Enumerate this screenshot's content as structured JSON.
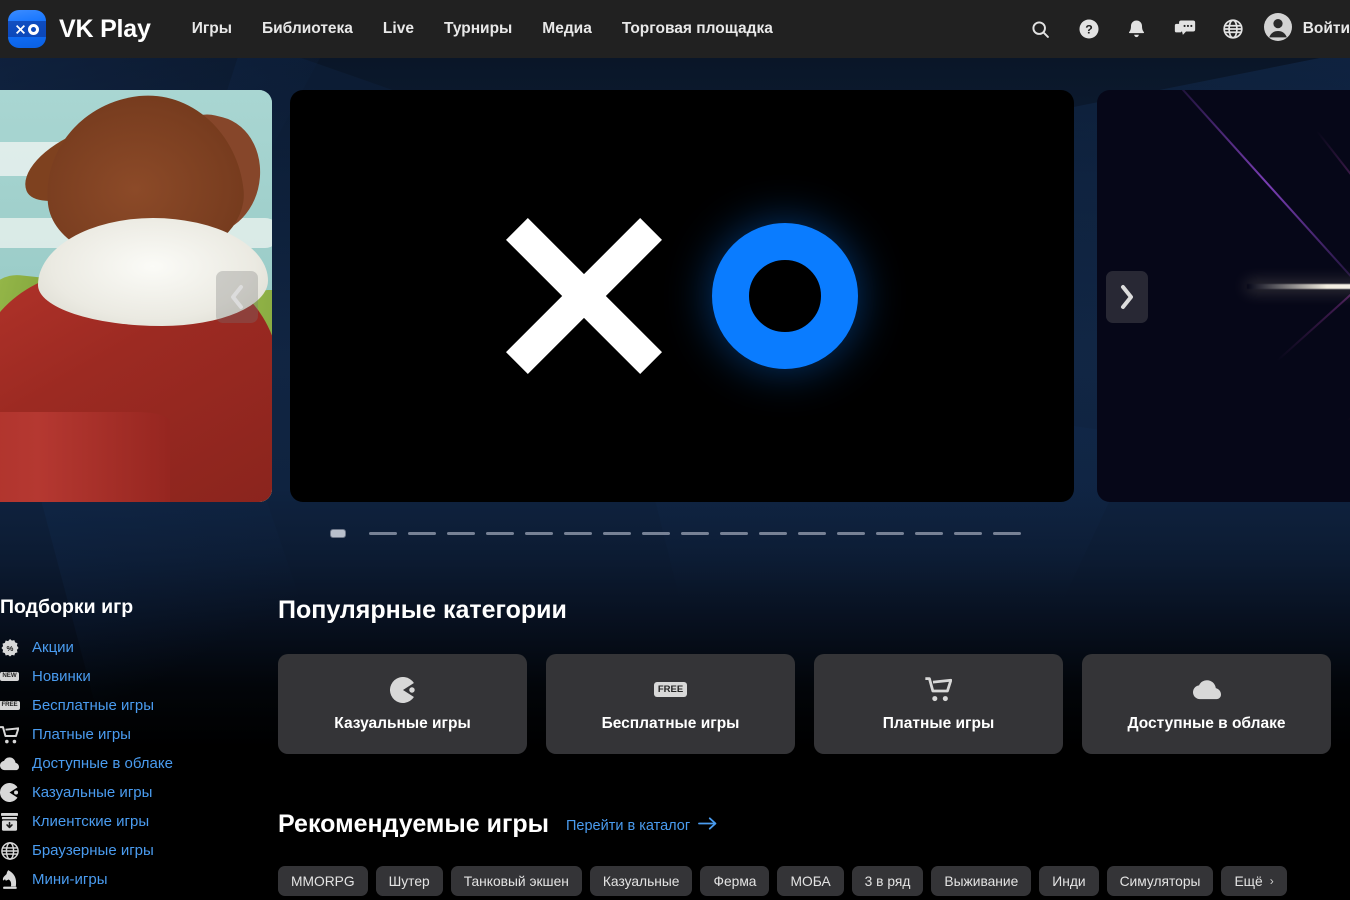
{
  "header": {
    "brand": "VK Play",
    "logo_icon": "vkplay-xo-logo-icon",
    "nav": [
      {
        "label": "Игры"
      },
      {
        "label": "Библиотека"
      },
      {
        "label": "Live"
      },
      {
        "label": "Турниры"
      },
      {
        "label": "Медиа"
      },
      {
        "label": "Торговая площадка"
      }
    ],
    "icons": [
      {
        "name": "search-icon"
      },
      {
        "name": "help-icon"
      },
      {
        "name": "notifications-bell-icon"
      },
      {
        "name": "chat-icon"
      },
      {
        "name": "language-globe-icon"
      }
    ],
    "login_label": "Войти",
    "avatar_icon": "user-avatar-icon"
  },
  "carousel": {
    "prev_label": "‹",
    "next_label": "›",
    "active_index": 0,
    "slide_count": 18,
    "main_slide": {
      "logo": "xo-logo",
      "x_color": "#ffffff",
      "o_color": "#0a7cff",
      "background": "#000000"
    }
  },
  "sidebar": {
    "title": "Подборки игр",
    "items": [
      {
        "label": "Акции",
        "icon": "discount-percent-icon"
      },
      {
        "label": "Новинки",
        "icon": "new-badge-icon",
        "badge": "NEW"
      },
      {
        "label": "Бесплатные игры",
        "icon": "free-badge-icon",
        "badge": "FREE"
      },
      {
        "label": "Платные игры",
        "icon": "shopping-cart-icon"
      },
      {
        "label": "Доступные в облаке",
        "icon": "cloud-icon"
      },
      {
        "label": "Казуальные игры",
        "icon": "pacman-icon"
      },
      {
        "label": "Клиентские игры",
        "icon": "download-box-icon"
      },
      {
        "label": "Браузерные игры",
        "icon": "globe-icon"
      },
      {
        "label": "Мини-игры",
        "icon": "chess-knight-icon"
      }
    ]
  },
  "main": {
    "categories_title": "Популярные категории",
    "categories": [
      {
        "label": "Казуальные игры",
        "icon": "pacman-icon"
      },
      {
        "label": "Бесплатные игры",
        "icon": "free-badge-icon",
        "badge": "FREE"
      },
      {
        "label": "Платные игры",
        "icon": "shopping-cart-icon"
      },
      {
        "label": "Доступные в облаке",
        "icon": "cloud-icon"
      }
    ],
    "recommended_title": "Рекомендуемые игры",
    "catalog_link": "Перейти в каталог",
    "catalog_link_icon": "arrow-right-icon",
    "tags": [
      {
        "label": "MMORPG"
      },
      {
        "label": "Шутер"
      },
      {
        "label": "Танковый экшен"
      },
      {
        "label": "Казуальные"
      },
      {
        "label": "Ферма"
      },
      {
        "label": "МОБА"
      },
      {
        "label": "3 в ряд"
      },
      {
        "label": "Выживание"
      },
      {
        "label": "Инди"
      },
      {
        "label": "Симуляторы"
      }
    ],
    "more_tag": {
      "label": "Ещё",
      "chevron": "›"
    }
  },
  "colors": {
    "accent_blue": "#0a7cff",
    "link_blue": "#4a9cf0",
    "header_bg": "#212121",
    "card_bg": "#343437",
    "page_bg_top": "#0f2340",
    "page_bg_bottom": "#000000"
  }
}
